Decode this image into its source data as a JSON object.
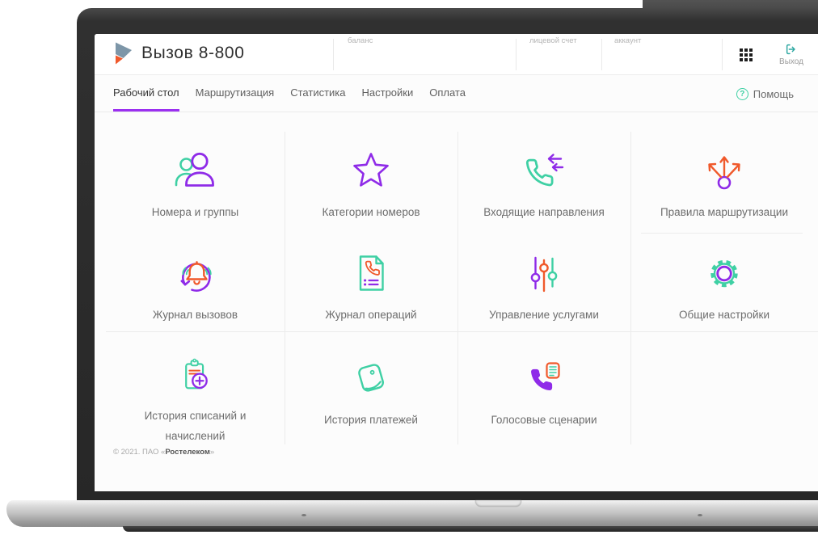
{
  "app": {
    "title": "Вызов 8-800"
  },
  "header": {
    "fields": [
      {
        "label": "баланс"
      },
      {
        "label": "лицевой счет"
      },
      {
        "label": "аккаунт"
      }
    ],
    "exit_label": "Выход"
  },
  "tabs": [
    {
      "label": "Рабочий стол",
      "active": true
    },
    {
      "label": "Маршрутизация",
      "active": false
    },
    {
      "label": "Статистика",
      "active": false
    },
    {
      "label": "Настройки",
      "active": false
    },
    {
      "label": "Оплата",
      "active": false
    }
  ],
  "help_label": "Помощь",
  "tiles": [
    {
      "label": "Номера и группы",
      "icon": "users-icon"
    },
    {
      "label": "Категории номеров",
      "icon": "star-icon"
    },
    {
      "label": "Входящие направления",
      "icon": "incoming-call-icon"
    },
    {
      "label": "Правила маршрутизации",
      "icon": "routing-arrows-icon"
    },
    {
      "label": "Журнал вызовов",
      "icon": "call-log-icon"
    },
    {
      "label": "Журнал операций",
      "icon": "operations-log-icon"
    },
    {
      "label": "Управление услугами",
      "icon": "sliders-icon"
    },
    {
      "label": "Общие настройки",
      "icon": "gear-icon"
    },
    {
      "label": "История списаний и начислений",
      "icon": "clipboard-plus-icon"
    },
    {
      "label": "История платежей",
      "icon": "wallet-icon"
    },
    {
      "label": "Голосовые сценарии",
      "icon": "voice-script-icon"
    }
  ],
  "footer": {
    "prefix": "© 2021. ПАО «",
    "brand": "Ростелеком",
    "suffix": "»"
  },
  "colors": {
    "purple": "#8f2be8",
    "green": "#3fd0a4",
    "orange": "#f0592b",
    "teal": "#2ea8a2",
    "tab_underline": "#9b30f0"
  }
}
